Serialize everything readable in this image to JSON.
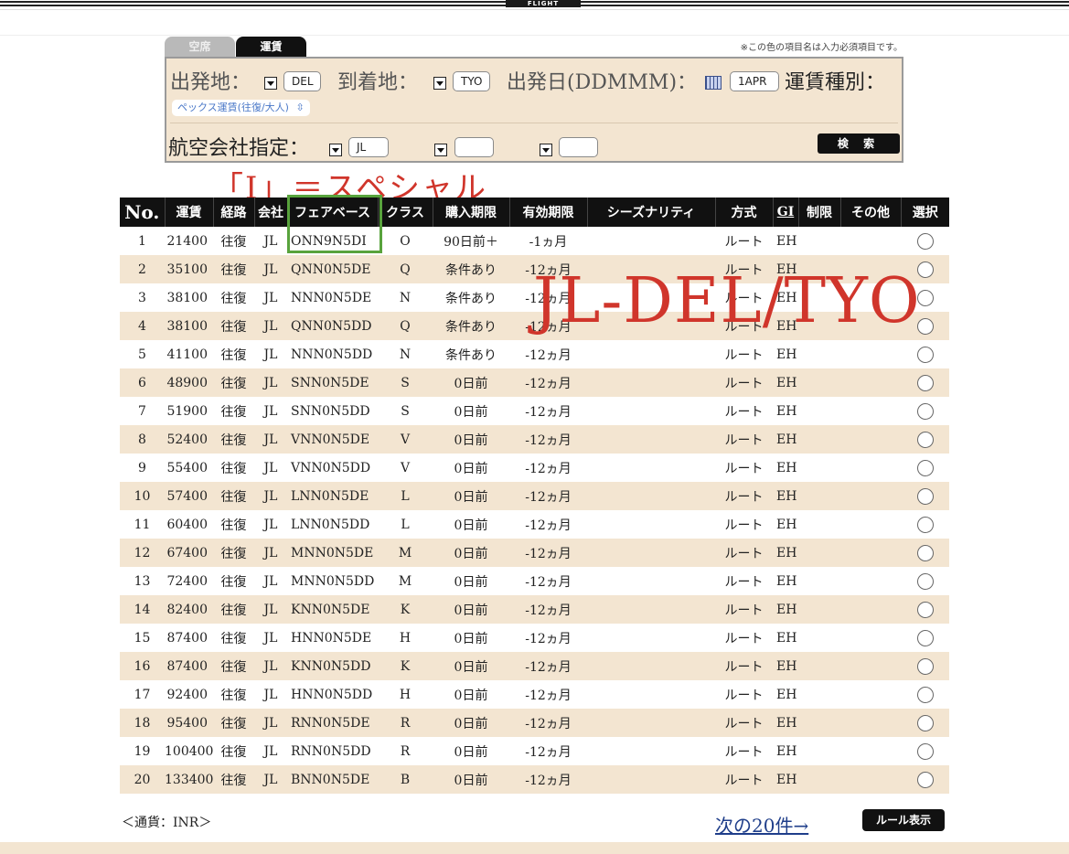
{
  "header": {
    "logo": "FLIGHT"
  },
  "tabs": [
    {
      "label": "空席"
    },
    {
      "label": "運賃"
    }
  ],
  "required_note": "※この色の項目名は入力必須項目です。",
  "form": {
    "departure_label": "出発地：",
    "departure_value": "DEL",
    "arrival_label": "到着地：",
    "arrival_value": "TYO",
    "date_label": "出発日(DDMMM)：",
    "date_value": "1APR",
    "fare_type_label": "運賃種別：",
    "fare_type_value": "ペックス運賃(往復/大人)",
    "airline_label": "航空会社指定：",
    "airline_values": [
      "JL",
      "",
      ""
    ],
    "search_label": "検 索"
  },
  "annotations": {
    "special": "「I」＝スペシャル",
    "route": "JL-DEL/TYO"
  },
  "table": {
    "headers": [
      "No.",
      "運賃",
      "経路",
      "会社",
      "フェアベース",
      "クラス",
      "購入期限",
      "有効期限",
      "シーズナリティ",
      "方式",
      "GI",
      "制限",
      "その他",
      "選択"
    ],
    "rows": [
      {
        "no": "1",
        "fare": "21400",
        "route": "往復",
        "airline": "JL",
        "fare_basis": "ONN9N5DI",
        "cls": "O",
        "purchase": "90日前＋",
        "validity": "-1ヵ月",
        "season": "",
        "method": "ルート",
        "gi": "EH",
        "limit": "",
        "other": ""
      },
      {
        "no": "2",
        "fare": "35100",
        "route": "往復",
        "airline": "JL",
        "fare_basis": "QNN0N5DE",
        "cls": "Q",
        "purchase": "条件あり",
        "validity": "-12ヵ月",
        "season": "",
        "method": "ルート",
        "gi": "EH",
        "limit": "",
        "other": ""
      },
      {
        "no": "3",
        "fare": "38100",
        "route": "往復",
        "airline": "JL",
        "fare_basis": "NNN0N5DE",
        "cls": "N",
        "purchase": "条件あり",
        "validity": "-12ヵ月",
        "season": "",
        "method": "ルート",
        "gi": "EH",
        "limit": "",
        "other": ""
      },
      {
        "no": "4",
        "fare": "38100",
        "route": "往復",
        "airline": "JL",
        "fare_basis": "QNN0N5DD",
        "cls": "Q",
        "purchase": "条件あり",
        "validity": "-12ヵ月",
        "season": "",
        "method": "ルート",
        "gi": "EH",
        "limit": "",
        "other": ""
      },
      {
        "no": "5",
        "fare": "41100",
        "route": "往復",
        "airline": "JL",
        "fare_basis": "NNN0N5DD",
        "cls": "N",
        "purchase": "条件あり",
        "validity": "-12ヵ月",
        "season": "",
        "method": "ルート",
        "gi": "EH",
        "limit": "",
        "other": ""
      },
      {
        "no": "6",
        "fare": "48900",
        "route": "往復",
        "airline": "JL",
        "fare_basis": "SNN0N5DE",
        "cls": "S",
        "purchase": "0日前",
        "validity": "-12ヵ月",
        "season": "",
        "method": "ルート",
        "gi": "EH",
        "limit": "",
        "other": ""
      },
      {
        "no": "7",
        "fare": "51900",
        "route": "往復",
        "airline": "JL",
        "fare_basis": "SNN0N5DD",
        "cls": "S",
        "purchase": "0日前",
        "validity": "-12ヵ月",
        "season": "",
        "method": "ルート",
        "gi": "EH",
        "limit": "",
        "other": ""
      },
      {
        "no": "8",
        "fare": "52400",
        "route": "往復",
        "airline": "JL",
        "fare_basis": "VNN0N5DE",
        "cls": "V",
        "purchase": "0日前",
        "validity": "-12ヵ月",
        "season": "",
        "method": "ルート",
        "gi": "EH",
        "limit": "",
        "other": ""
      },
      {
        "no": "9",
        "fare": "55400",
        "route": "往復",
        "airline": "JL",
        "fare_basis": "VNN0N5DD",
        "cls": "V",
        "purchase": "0日前",
        "validity": "-12ヵ月",
        "season": "",
        "method": "ルート",
        "gi": "EH",
        "limit": "",
        "other": ""
      },
      {
        "no": "10",
        "fare": "57400",
        "route": "往復",
        "airline": "JL",
        "fare_basis": "LNN0N5DE",
        "cls": "L",
        "purchase": "0日前",
        "validity": "-12ヵ月",
        "season": "",
        "method": "ルート",
        "gi": "EH",
        "limit": "",
        "other": ""
      },
      {
        "no": "11",
        "fare": "60400",
        "route": "往復",
        "airline": "JL",
        "fare_basis": "LNN0N5DD",
        "cls": "L",
        "purchase": "0日前",
        "validity": "-12ヵ月",
        "season": "",
        "method": "ルート",
        "gi": "EH",
        "limit": "",
        "other": ""
      },
      {
        "no": "12",
        "fare": "67400",
        "route": "往復",
        "airline": "JL",
        "fare_basis": "MNN0N5DE",
        "cls": "M",
        "purchase": "0日前",
        "validity": "-12ヵ月",
        "season": "",
        "method": "ルート",
        "gi": "EH",
        "limit": "",
        "other": ""
      },
      {
        "no": "13",
        "fare": "72400",
        "route": "往復",
        "airline": "JL",
        "fare_basis": "MNN0N5DD",
        "cls": "M",
        "purchase": "0日前",
        "validity": "-12ヵ月",
        "season": "",
        "method": "ルート",
        "gi": "EH",
        "limit": "",
        "other": ""
      },
      {
        "no": "14",
        "fare": "82400",
        "route": "往復",
        "airline": "JL",
        "fare_basis": "KNN0N5DE",
        "cls": "K",
        "purchase": "0日前",
        "validity": "-12ヵ月",
        "season": "",
        "method": "ルート",
        "gi": "EH",
        "limit": "",
        "other": ""
      },
      {
        "no": "15",
        "fare": "87400",
        "route": "往復",
        "airline": "JL",
        "fare_basis": "HNN0N5DE",
        "cls": "H",
        "purchase": "0日前",
        "validity": "-12ヵ月",
        "season": "",
        "method": "ルート",
        "gi": "EH",
        "limit": "",
        "other": ""
      },
      {
        "no": "16",
        "fare": "87400",
        "route": "往復",
        "airline": "JL",
        "fare_basis": "KNN0N5DD",
        "cls": "K",
        "purchase": "0日前",
        "validity": "-12ヵ月",
        "season": "",
        "method": "ルート",
        "gi": "EH",
        "limit": "",
        "other": ""
      },
      {
        "no": "17",
        "fare": "92400",
        "route": "往復",
        "airline": "JL",
        "fare_basis": "HNN0N5DD",
        "cls": "H",
        "purchase": "0日前",
        "validity": "-12ヵ月",
        "season": "",
        "method": "ルート",
        "gi": "EH",
        "limit": "",
        "other": ""
      },
      {
        "no": "18",
        "fare": "95400",
        "route": "往復",
        "airline": "JL",
        "fare_basis": "RNN0N5DE",
        "cls": "R",
        "purchase": "0日前",
        "validity": "-12ヵ月",
        "season": "",
        "method": "ルート",
        "gi": "EH",
        "limit": "",
        "other": ""
      },
      {
        "no": "19",
        "fare": "100400",
        "route": "往復",
        "airline": "JL",
        "fare_basis": "RNN0N5DD",
        "cls": "R",
        "purchase": "0日前",
        "validity": "-12ヵ月",
        "season": "",
        "method": "ルート",
        "gi": "EH",
        "limit": "",
        "other": ""
      },
      {
        "no": "20",
        "fare": "133400",
        "route": "往復",
        "airline": "JL",
        "fare_basis": "BNN0N5DE",
        "cls": "B",
        "purchase": "0日前",
        "validity": "-12ヵ月",
        "season": "",
        "method": "ルート",
        "gi": "EH",
        "limit": "",
        "other": ""
      }
    ]
  },
  "footer": {
    "currency": "＜通貨：INR＞",
    "next_link": "次の20件→",
    "rule_button": "ルール表示"
  },
  "colors": {
    "header_bg": "#111111",
    "panel_bg": "#f3e5d1",
    "stripe_row": "#f3e5d1",
    "annotation_red": "#d0352b",
    "highlight_green": "#58a33c",
    "link_blue": "#1f3e8a"
  }
}
